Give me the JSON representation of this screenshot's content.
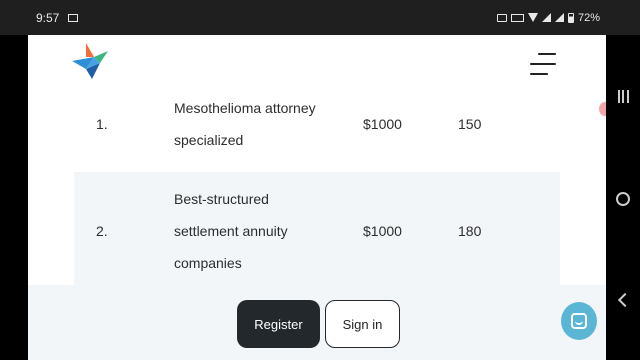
{
  "status_bar": {
    "time": "9:57",
    "battery": "72%",
    "icons": [
      "cast-icon",
      "notification-icon",
      "nfc-icon",
      "wifi-icon",
      "signal-icon",
      "battery-icon"
    ]
  },
  "nav_bar": {
    "icons": [
      "recent-apps-icon",
      "home-icon",
      "back-icon"
    ]
  },
  "header": {
    "logo": "bird-logo",
    "menu_icon": "hamburger-menu-icon"
  },
  "table": {
    "rows": [
      {
        "num": "1.",
        "name_lines": [
          "Mesothelioma attorney",
          "specialized"
        ],
        "price": "$1000",
        "count": "150"
      },
      {
        "num": "2.",
        "name_lines": [
          "Best-structured",
          "settlement annuity",
          "companies"
        ],
        "price": "$1000",
        "count": "180"
      }
    ]
  },
  "bottom_bar": {
    "register_label": "Register",
    "signin_label": "Sign in"
  },
  "chat": {
    "icon": "chat-icon"
  },
  "colors": {
    "status_bar_bg": "#1f1f1f",
    "row_alt_bg": "#f3f6f9",
    "button_dark": "#23282d",
    "chat_accent": "#5bb6d6"
  }
}
